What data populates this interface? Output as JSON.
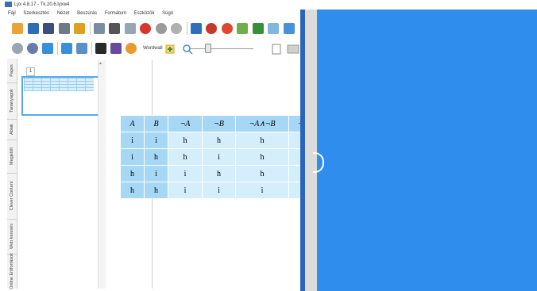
{
  "window": {
    "title": "Lyx 4.8.17 - Tk.20.6.lyxw4"
  },
  "menu": [
    "Fájl",
    "Szerkesztés",
    "Nézet",
    "Beszúrás",
    "Formátum",
    "Eszközök",
    "Súgó"
  ],
  "toolbar1": [
    {
      "icon": "new-document-icon",
      "color": "#e8a33a"
    },
    {
      "icon": "open-book-icon",
      "color": "#2f6db5"
    },
    {
      "icon": "save-icon",
      "color": "#3b4f7a"
    },
    {
      "icon": "print-icon",
      "color": "#6d7a8a"
    },
    {
      "icon": "lock-icon",
      "color": "#e0a020"
    },
    {
      "icon": "copy-icon",
      "color": "#7a8da3"
    },
    {
      "icon": "cut-icon",
      "color": "#555555"
    },
    {
      "icon": "paste-icon",
      "color": "#9aa5b3"
    },
    {
      "icon": "cancel-icon",
      "color": "#d9362b"
    },
    {
      "icon": "undo-icon",
      "color": "#9a9a9a"
    },
    {
      "icon": "redo-icon",
      "color": "#b0b0b0"
    },
    {
      "icon": "puzzle-icon",
      "color": "#2b6fbf"
    },
    {
      "icon": "award-icon",
      "color": "#c7372f"
    },
    {
      "icon": "clock-icon",
      "color": "#e0482f"
    },
    {
      "icon": "note-icon",
      "color": "#6fae4a"
    },
    {
      "icon": "check-icon",
      "color": "#3a8f3a"
    },
    {
      "icon": "frame-icon",
      "color": "#7fb7e0"
    },
    {
      "icon": "page-view-icon",
      "color": "#4a90d9"
    }
  ],
  "toolbar2": [
    {
      "icon": "circle-icon",
      "color": "#9aa5b3"
    },
    {
      "icon": "record-icon",
      "color": "#6a7bb0"
    },
    {
      "icon": "cursor-icon",
      "color": "#3a8fd9"
    },
    {
      "icon": "arrow-right-icon",
      "color": "#3a8fd9"
    },
    {
      "icon": "calculator-icon",
      "color": "#5a8fc9"
    },
    {
      "icon": "keyboard-icon",
      "color": "#2a2a2a"
    },
    {
      "icon": "group-icon",
      "color": "#6a4aa0"
    },
    {
      "icon": "globe-icon",
      "color": "#e89a30"
    }
  ],
  "wordwall_label": "Wordwall",
  "side_tabs": [
    "Pages",
    "Tananyagok",
    "Ablak",
    "Megjelölt",
    "Clever Content",
    "Web keresés",
    "Online Erőforrások"
  ],
  "page_number": "1",
  "truth_table": {
    "headers": [
      "A",
      "B",
      "¬A",
      "¬B",
      "¬A∧¬B",
      "¬"
    ],
    "rows": [
      [
        "i",
        "i",
        "h",
        "h",
        "h",
        ""
      ],
      [
        "i",
        "h",
        "h",
        "i",
        "h",
        ""
      ],
      [
        "h",
        "i",
        "i",
        "h",
        "h",
        ""
      ],
      [
        "h",
        "h",
        "i",
        "i",
        "i",
        ""
      ]
    ]
  },
  "colors": {
    "table_header": "#a6d8f5",
    "table_cell": "#d5eefb",
    "blue_pane": "#2f8ded"
  }
}
